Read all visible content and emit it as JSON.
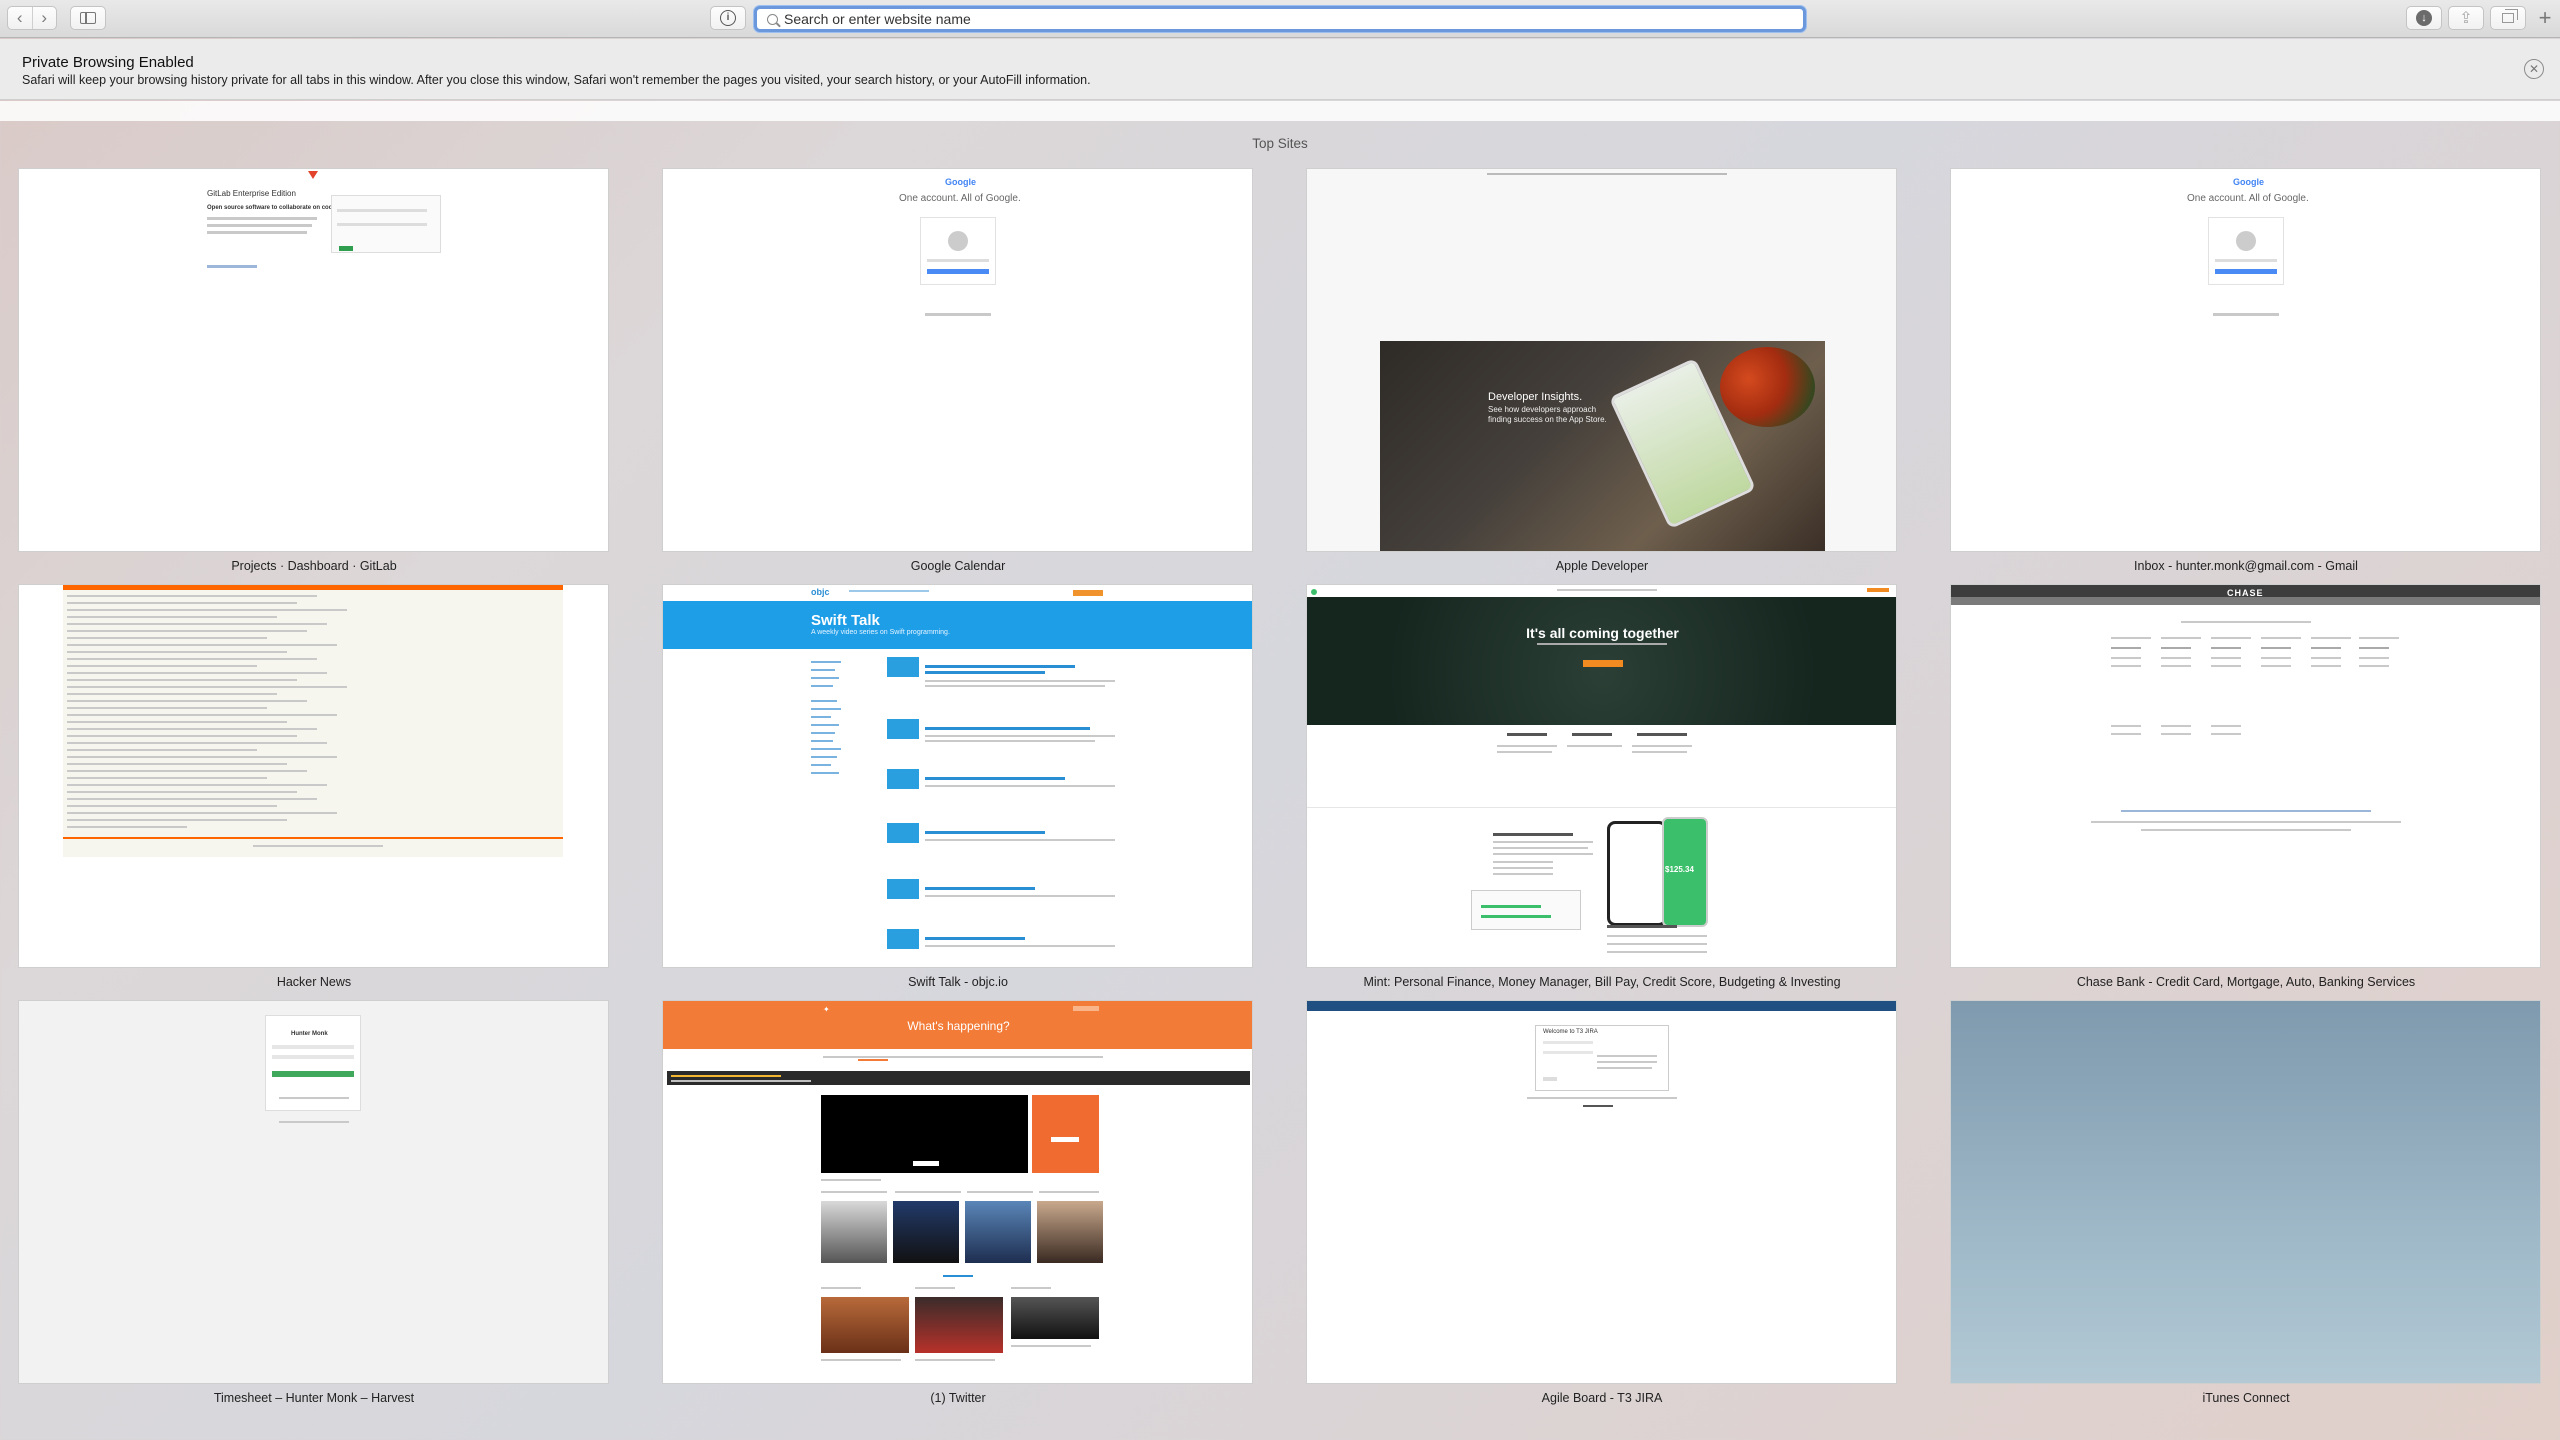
{
  "toolbar": {
    "back_icon": "chevron-left-icon",
    "forward_icon": "chevron-right-icon",
    "address_placeholder": "Search or enter website name",
    "reader_glyph": "i"
  },
  "banner": {
    "title": "Private Browsing Enabled",
    "text": "Safari will keep your browsing history private for all tabs in this window. After you close this window, Safari won't remember the pages you visited, your search history, or your AutoFill information."
  },
  "top_sites": {
    "title": "Top Sites",
    "tiles": [
      {
        "label": "Projects · Dashboard · GitLab",
        "heading": "GitLab Enterprise Edition",
        "subheading": "Open source software to collaborate on code"
      },
      {
        "label": "Google Calendar",
        "logo": "Google",
        "heading": "One account. All of Google."
      },
      {
        "label": "Apple Developer",
        "heading": "Developer Insights.",
        "subheading": "See how developers approach finding success on the App Store."
      },
      {
        "label": "Inbox - hunter.monk@gmail.com - Gmail",
        "logo": "Google",
        "heading": "One account. All of Google."
      },
      {
        "label": "Hacker News"
      },
      {
        "label": "Swift Talk - objc.io",
        "logo": "objc",
        "heading": "Swift Talk",
        "subheading": "A weekly video series on Swift programming."
      },
      {
        "label": "Mint: Personal Finance, Money Manager, Bill Pay, Credit Score, Budgeting & Investing",
        "heading": "It's all coming together",
        "price": "$125.34"
      },
      {
        "label": "Chase Bank - Credit Card, Mortgage, Auto, Banking Services",
        "logo": "CHASE"
      },
      {
        "label": "Timesheet – Hunter Monk – Harvest",
        "heading": "Hunter Monk"
      },
      {
        "label": "(1) Twitter",
        "heading": "What's happening?"
      },
      {
        "label": "Agile Board - T3 JIRA",
        "heading": "Welcome to T3 JIRA"
      },
      {
        "label": "iTunes Connect"
      }
    ]
  }
}
